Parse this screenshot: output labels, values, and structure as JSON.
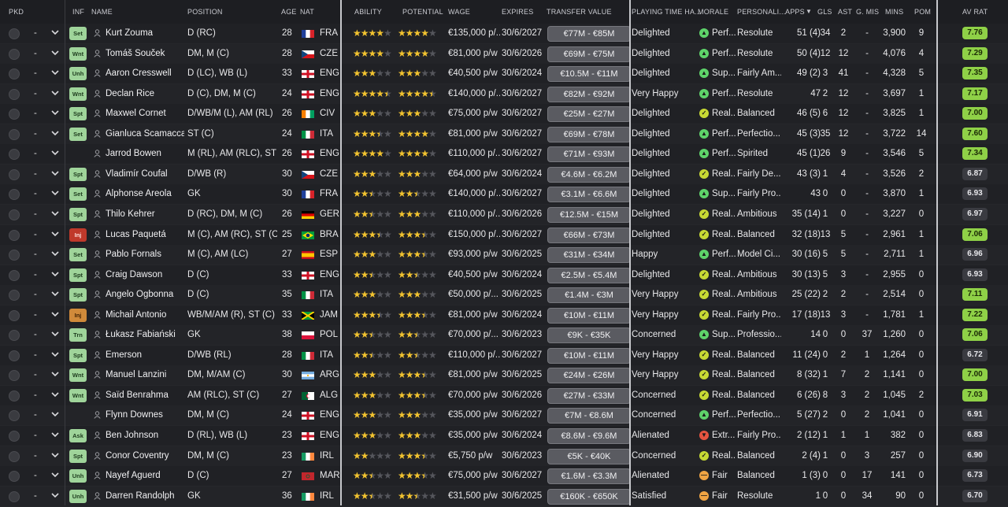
{
  "headers": {
    "pkd": "PKD",
    "inf": "INF",
    "name": "NAME",
    "position": "POSITION",
    "age": "AGE",
    "nat": "NAT",
    "ability": "ABILITY",
    "potential": "POTENTIAL",
    "wage": "WAGE",
    "expires": "EXPIRES",
    "transfer_value": "TRANSFER VALUE",
    "playing_time": "PLAYING TIME HA...",
    "morale": "MORALE",
    "personality": "PERSONALI...",
    "apps": "APPS",
    "gls": "GLS",
    "ast": "AST",
    "gmis": "G. MIS",
    "mins": "MINS",
    "pom": "POM",
    "av_rat": "AV RAT"
  },
  "sort_indicator_icon": "sort-descending-icon",
  "colors": {
    "rating_high": "#8fd147",
    "rating_low": "#3a3b41",
    "injury": "#c0392b",
    "star": "#f2c330"
  },
  "players": [
    {
      "dash": "-",
      "inf": "Set",
      "infc": "g",
      "name": "Kurt Zouma",
      "pos": "D (RC)",
      "age": "28",
      "nat": "FRA",
      "flag": "fr",
      "ab": 4,
      "pot": 4,
      "abh": 0,
      "poth": 0,
      "wage": "€135,000 p/...",
      "exp": "30/6/2027",
      "tv": "€77M - €85M",
      "pt": "Delighted",
      "mood": "g",
      "moodt": "Perf...",
      "pers": "Resolute",
      "apps": "51 (4)",
      "gls": "34",
      "ast": "2",
      "gmis": "-",
      "mins": "3,900",
      "pom": "9",
      "rat": "7.76",
      "hi": true
    },
    {
      "dash": "-",
      "inf": "Wnt",
      "infc": "g",
      "name": "Tomáš Souček",
      "pos": "DM, M (C)",
      "age": "28",
      "nat": "CZE",
      "flag": "cz",
      "ab": 4,
      "pot": 4,
      "abh": 0,
      "poth": 0,
      "wage": "€81,000 p/w",
      "exp": "30/6/2026",
      "tv": "€69M - €75M",
      "pt": "Delighted",
      "mood": "g",
      "moodt": "Perf...",
      "pers": "Resolute",
      "apps": "50 (4)",
      "gls": "12",
      "ast": "12",
      "gmis": "-",
      "mins": "4,076",
      "pom": "4",
      "rat": "7.29",
      "hi": true
    },
    {
      "dash": "-",
      "inf": "Unh",
      "infc": "g",
      "name": "Aaron Cresswell",
      "pos": "D (LC), WB (L)",
      "age": "33",
      "nat": "ENG",
      "flag": "en",
      "ab": 3,
      "pot": 3,
      "abh": 0,
      "poth": 0,
      "wage": "€40,500 p/w",
      "exp": "30/6/2024",
      "tv": "€10.5M - €11M",
      "pt": "Delighted",
      "mood": "g",
      "moodt": "Sup...",
      "pers": "Fairly Am...",
      "apps": "49 (2)",
      "gls": "3",
      "ast": "41",
      "gmis": "-",
      "mins": "4,328",
      "pom": "5",
      "rat": "7.35",
      "hi": true
    },
    {
      "dash": "-",
      "inf": "Wnt",
      "infc": "g",
      "name": "Declan Rice",
      "pos": "D (C), DM, M (C)",
      "age": "24",
      "nat": "ENG",
      "flag": "en",
      "ab": 4,
      "pot": 4,
      "abh": 1,
      "poth": 1,
      "wage": "€140,000 p/...",
      "exp": "30/6/2027",
      "tv": "€82M - €92M",
      "pt": "Very Happy",
      "mood": "g",
      "moodt": "Perf...",
      "pers": "Resolute",
      "apps": "47",
      "gls": "2",
      "ast": "12",
      "gmis": "-",
      "mins": "3,697",
      "pom": "1",
      "rat": "7.17",
      "hi": true
    },
    {
      "dash": "-",
      "inf": "Spt",
      "infc": "g",
      "name": "Maxwel Cornet",
      "pos": "D/WB/M (L), AM (RL)",
      "age": "26",
      "nat": "CIV",
      "flag": "ci",
      "ab": 3,
      "pot": 3,
      "abh": 0,
      "poth": 0,
      "wage": "€75,000 p/w",
      "exp": "30/6/2027",
      "tv": "€25M - €27M",
      "pt": "Delighted",
      "mood": "y",
      "moodt": "Real...",
      "pers": "Balanced",
      "apps": "46 (5)",
      "gls": "6",
      "ast": "12",
      "gmis": "-",
      "mins": "3,825",
      "pom": "1",
      "rat": "7.00",
      "hi": true
    },
    {
      "dash": "-",
      "inf": "Set",
      "infc": "g",
      "name": "Gianluca Scamacca",
      "pos": "ST (C)",
      "age": "24",
      "nat": "ITA",
      "flag": "it",
      "ab": 3,
      "pot": 4,
      "abh": 1,
      "poth": 0,
      "wage": "€81,000 p/w",
      "exp": "30/6/2027",
      "tv": "€69M - €78M",
      "pt": "Delighted",
      "mood": "g",
      "moodt": "Perf...",
      "pers": "Perfectio...",
      "apps": "45 (3)",
      "gls": "35",
      "ast": "12",
      "gmis": "-",
      "mins": "3,722",
      "pom": "14",
      "rat": "7.60",
      "hi": true
    },
    {
      "dash": "-",
      "inf": "",
      "infc": "",
      "name": "Jarrod Bowen",
      "pos": "M (RL), AM (RLC), ST (C)",
      "age": "26",
      "nat": "ENG",
      "flag": "en",
      "ab": 4,
      "pot": 4,
      "abh": 0,
      "poth": 0,
      "wage": "€110,000 p/...",
      "exp": "30/6/2027",
      "tv": "€71M - €93M",
      "pt": "Delighted",
      "mood": "g",
      "moodt": "Perf...",
      "pers": "Spirited",
      "apps": "45 (1)",
      "gls": "26",
      "ast": "9",
      "gmis": "-",
      "mins": "3,546",
      "pom": "5",
      "rat": "7.34",
      "hi": true
    },
    {
      "dash": "-",
      "inf": "Spt",
      "infc": "g",
      "name": "Vladimír Coufal",
      "pos": "D/WB (R)",
      "age": "30",
      "nat": "CZE",
      "flag": "cz",
      "ab": 3,
      "pot": 3,
      "abh": 0,
      "poth": 0,
      "wage": "€64,000 p/w",
      "exp": "30/6/2024",
      "tv": "€4.6M - €6.2M",
      "pt": "Delighted",
      "mood": "y",
      "moodt": "Real...",
      "pers": "Fairly De...",
      "apps": "43 (3)",
      "gls": "1",
      "ast": "4",
      "gmis": "-",
      "mins": "3,526",
      "pom": "2",
      "rat": "6.87",
      "hi": false
    },
    {
      "dash": "-",
      "inf": "Set",
      "infc": "g",
      "name": "Alphonse Areola",
      "pos": "GK",
      "age": "30",
      "nat": "FRA",
      "flag": "fr",
      "ab": 2,
      "pot": 2,
      "abh": 1,
      "poth": 1,
      "wage": "€140,000 p/...",
      "exp": "30/6/2027",
      "tv": "€3.1M - €6.6M",
      "pt": "Delighted",
      "mood": "g",
      "moodt": "Sup...",
      "pers": "Fairly Pro...",
      "apps": "43",
      "gls": "0",
      "ast": "0",
      "gmis": "-",
      "mins": "3,870",
      "pom": "1",
      "rat": "6.93",
      "hi": false
    },
    {
      "dash": "-",
      "inf": "Spt",
      "infc": "g",
      "name": "Thilo Kehrer",
      "pos": "D (RC), DM, M (C)",
      "age": "26",
      "nat": "GER",
      "flag": "de",
      "ab": 2,
      "pot": 3,
      "abh": 1,
      "poth": 0,
      "wage": "€110,000 p/...",
      "exp": "30/6/2026",
      "tv": "€12.5M - €15M",
      "pt": "Delighted",
      "mood": "y",
      "moodt": "Real...",
      "pers": "Ambitious",
      "apps": "35 (14)",
      "gls": "1",
      "ast": "0",
      "gmis": "-",
      "mins": "3,227",
      "pom": "0",
      "rat": "6.97",
      "hi": false
    },
    {
      "dash": "-",
      "inf": "Inj",
      "infc": "r",
      "name": "Lucas Paquetá",
      "pos": "M (C), AM (RC), ST (C)",
      "age": "25",
      "nat": "BRA",
      "flag": "br",
      "ab": 3,
      "pot": 3,
      "abh": 1,
      "poth": 1,
      "wage": "€150,000 p/...",
      "exp": "30/6/2027",
      "tv": "€66M - €73M",
      "pt": "Delighted",
      "mood": "y",
      "moodt": "Real...",
      "pers": "Balanced",
      "apps": "32 (18)",
      "gls": "13",
      "ast": "5",
      "gmis": "-",
      "mins": "2,961",
      "pom": "1",
      "rat": "7.06",
      "hi": true
    },
    {
      "dash": "-",
      "inf": "Set",
      "infc": "g",
      "name": "Pablo Fornals",
      "pos": "M (C), AM (LC)",
      "age": "27",
      "nat": "ESP",
      "flag": "es",
      "ab": 3,
      "pot": 3,
      "abh": 0,
      "poth": 1,
      "wage": "€93,000 p/w",
      "exp": "30/6/2025",
      "tv": "€31M - €34M",
      "pt": "Happy",
      "mood": "g",
      "moodt": "Perf...",
      "pers": "Model Ci...",
      "apps": "30 (16)",
      "gls": "5",
      "ast": "5",
      "gmis": "-",
      "mins": "2,711",
      "pom": "1",
      "rat": "6.96",
      "hi": false
    },
    {
      "dash": "-",
      "inf": "Spt",
      "infc": "g",
      "name": "Craig Dawson",
      "pos": "D (C)",
      "age": "33",
      "nat": "ENG",
      "flag": "en",
      "ab": 2,
      "pot": 2,
      "abh": 1,
      "poth": 1,
      "wage": "€40,500 p/w",
      "exp": "30/6/2024",
      "tv": "€2.5M - €5.4M",
      "pt": "Delighted",
      "mood": "y",
      "moodt": "Real...",
      "pers": "Ambitious",
      "apps": "30 (13)",
      "gls": "5",
      "ast": "3",
      "gmis": "-",
      "mins": "2,955",
      "pom": "0",
      "rat": "6.93",
      "hi": false
    },
    {
      "dash": "-",
      "inf": "Spt",
      "infc": "g",
      "name": "Angelo Ogbonna",
      "pos": "D (C)",
      "age": "35",
      "nat": "ITA",
      "flag": "it",
      "ab": 3,
      "pot": 3,
      "abh": 0,
      "poth": 0,
      "wage": "€50,000 p/...",
      "exp": "30/6/2025",
      "tv": "€1.4M - €3M",
      "pt": "Very Happy",
      "mood": "y",
      "moodt": "Real...",
      "pers": "Ambitious",
      "apps": "25 (22)",
      "gls": "2",
      "ast": "2",
      "gmis": "-",
      "mins": "2,514",
      "pom": "0",
      "rat": "7.11",
      "hi": true
    },
    {
      "dash": "-",
      "inf": "Inj",
      "infc": "o",
      "name": "Michail Antonio",
      "pos": "WB/M/AM (R), ST (C)",
      "age": "33",
      "nat": "JAM",
      "flag": "jm",
      "ab": 3,
      "pot": 3,
      "abh": 1,
      "poth": 1,
      "wage": "€81,000 p/w",
      "exp": "30/6/2024",
      "tv": "€10M - €11M",
      "pt": "Very Happy",
      "mood": "y",
      "moodt": "Real...",
      "pers": "Fairly Pro...",
      "apps": "17 (18)",
      "gls": "13",
      "ast": "3",
      "gmis": "-",
      "mins": "1,781",
      "pom": "1",
      "rat": "7.22",
      "hi": true
    },
    {
      "dash": "-",
      "inf": "Trn",
      "infc": "g",
      "name": "Łukasz Fabiański",
      "pos": "GK",
      "age": "38",
      "nat": "POL",
      "flag": "pl",
      "ab": 2,
      "pot": 2,
      "abh": 1,
      "poth": 1,
      "wage": "€70,000 p/...",
      "exp": "30/6/2023",
      "tv": "€9K - €35K",
      "pt": "Concerned",
      "mood": "g",
      "moodt": "Sup...",
      "pers": "Professio...",
      "apps": "14",
      "gls": "0",
      "ast": "0",
      "gmis": "37",
      "mins": "1,260",
      "pom": "0",
      "rat": "7.06",
      "hi": true
    },
    {
      "dash": "-",
      "inf": "Spt",
      "infc": "g",
      "name": "Emerson",
      "pos": "D/WB (RL)",
      "age": "28",
      "nat": "ITA",
      "flag": "it",
      "ab": 2,
      "pot": 2,
      "abh": 1,
      "poth": 1,
      "wage": "€110,000 p/...",
      "exp": "30/6/2027",
      "tv": "€10M - €11M",
      "pt": "Very Happy",
      "mood": "y",
      "moodt": "Real...",
      "pers": "Balanced",
      "apps": "11 (24)",
      "gls": "0",
      "ast": "2",
      "gmis": "1",
      "mins": "1,264",
      "pom": "0",
      "rat": "6.72",
      "hi": false
    },
    {
      "dash": "-",
      "inf": "Wnt",
      "infc": "g",
      "name": "Manuel Lanzini",
      "pos": "DM, M/AM (C)",
      "age": "30",
      "nat": "ARG",
      "flag": "ar",
      "ab": 3,
      "pot": 3,
      "abh": 0,
      "poth": 1,
      "wage": "€81,000 p/w",
      "exp": "30/6/2025",
      "tv": "€24M - €26M",
      "pt": "Very Happy",
      "mood": "y",
      "moodt": "Real...",
      "pers": "Balanced",
      "apps": "8 (32)",
      "gls": "1",
      "ast": "7",
      "gmis": "2",
      "mins": "1,141",
      "pom": "0",
      "rat": "7.00",
      "hi": true
    },
    {
      "dash": "-",
      "inf": "Wnt",
      "infc": "g",
      "name": "Saïd Benrahma",
      "pos": "AM (RLC), ST (C)",
      "age": "27",
      "nat": "ALG",
      "flag": "dz",
      "ab": 3,
      "pot": 3,
      "abh": 0,
      "poth": 1,
      "wage": "€70,000 p/w",
      "exp": "30/6/2026",
      "tv": "€27M - €33M",
      "pt": "Concerned",
      "mood": "y",
      "moodt": "Real...",
      "pers": "Balanced",
      "apps": "6 (26)",
      "gls": "8",
      "ast": "3",
      "gmis": "2",
      "mins": "1,045",
      "pom": "2",
      "rat": "7.03",
      "hi": true
    },
    {
      "dash": "-",
      "inf": "",
      "infc": "",
      "name": "Flynn Downes",
      "pos": "DM, M (C)",
      "age": "24",
      "nat": "ENG",
      "flag": "en",
      "ab": 3,
      "pot": 3,
      "abh": 0,
      "poth": 0,
      "wage": "€35,000 p/w",
      "exp": "30/6/2027",
      "tv": "€7M - €8.6M",
      "pt": "Concerned",
      "mood": "g",
      "moodt": "Perf...",
      "pers": "Perfectio...",
      "apps": "5 (27)",
      "gls": "2",
      "ast": "0",
      "gmis": "2",
      "mins": "1,041",
      "pom": "0",
      "rat": "6.91",
      "hi": false
    },
    {
      "dash": "-",
      "inf": "Ask",
      "infc": "g",
      "name": "Ben Johnson",
      "pos": "D (RL), WB (L)",
      "age": "23",
      "nat": "ENG",
      "flag": "en",
      "ab": 3,
      "pot": 3,
      "abh": 0,
      "poth": 0,
      "wage": "€35,000 p/w",
      "exp": "30/6/2024",
      "tv": "€8.6M - €9.6M",
      "pt": "Alienated",
      "mood": "r",
      "moodt": "Extr...",
      "pers": "Fairly Pro...",
      "apps": "2 (12)",
      "gls": "1",
      "ast": "1",
      "gmis": "1",
      "mins": "382",
      "pom": "0",
      "rat": "6.83",
      "hi": false
    },
    {
      "dash": "-",
      "inf": "Spt",
      "infc": "g",
      "name": "Conor Coventry",
      "pos": "DM, M (C)",
      "age": "23",
      "nat": "IRL",
      "flag": "ie",
      "ab": 2,
      "pot": 3,
      "abh": 0,
      "poth": 1,
      "wage": "€5,750 p/w",
      "exp": "30/6/2023",
      "tv": "€5K - €40K",
      "pt": "Concerned",
      "mood": "y",
      "moodt": "Real...",
      "pers": "Balanced",
      "apps": "2 (4)",
      "gls": "1",
      "ast": "0",
      "gmis": "3",
      "mins": "257",
      "pom": "0",
      "rat": "6.90",
      "hi": false
    },
    {
      "dash": "-",
      "inf": "Unh",
      "infc": "g",
      "name": "Nayef Aguerd",
      "pos": "D (C)",
      "age": "27",
      "nat": "MAR",
      "flag": "ma",
      "ab": 2,
      "pot": 3,
      "abh": 1,
      "poth": 1,
      "wage": "€75,000 p/w",
      "exp": "30/6/2027",
      "tv": "€1.6M - €3.3M",
      "pt": "Alienated",
      "mood": "o",
      "moodt": "Fair",
      "pers": "Balanced",
      "apps": "1 (3)",
      "gls": "0",
      "ast": "0",
      "gmis": "17",
      "mins": "141",
      "pom": "0",
      "rat": "6.73",
      "hi": false
    },
    {
      "dash": "-",
      "inf": "Unh",
      "infc": "g",
      "name": "Darren Randolph",
      "pos": "GK",
      "age": "36",
      "nat": "IRL",
      "flag": "ie",
      "ab": 2,
      "pot": 2,
      "abh": 1,
      "poth": 1,
      "wage": "€31,500 p/w",
      "exp": "30/6/2025",
      "tv": "€160K - €650K",
      "pt": "Satisfied",
      "mood": "o",
      "moodt": "Fair",
      "pers": "Resolute",
      "apps": "1",
      "gls": "0",
      "ast": "0",
      "gmis": "34",
      "mins": "90",
      "pom": "0",
      "rat": "6.70",
      "hi": false
    }
  ]
}
